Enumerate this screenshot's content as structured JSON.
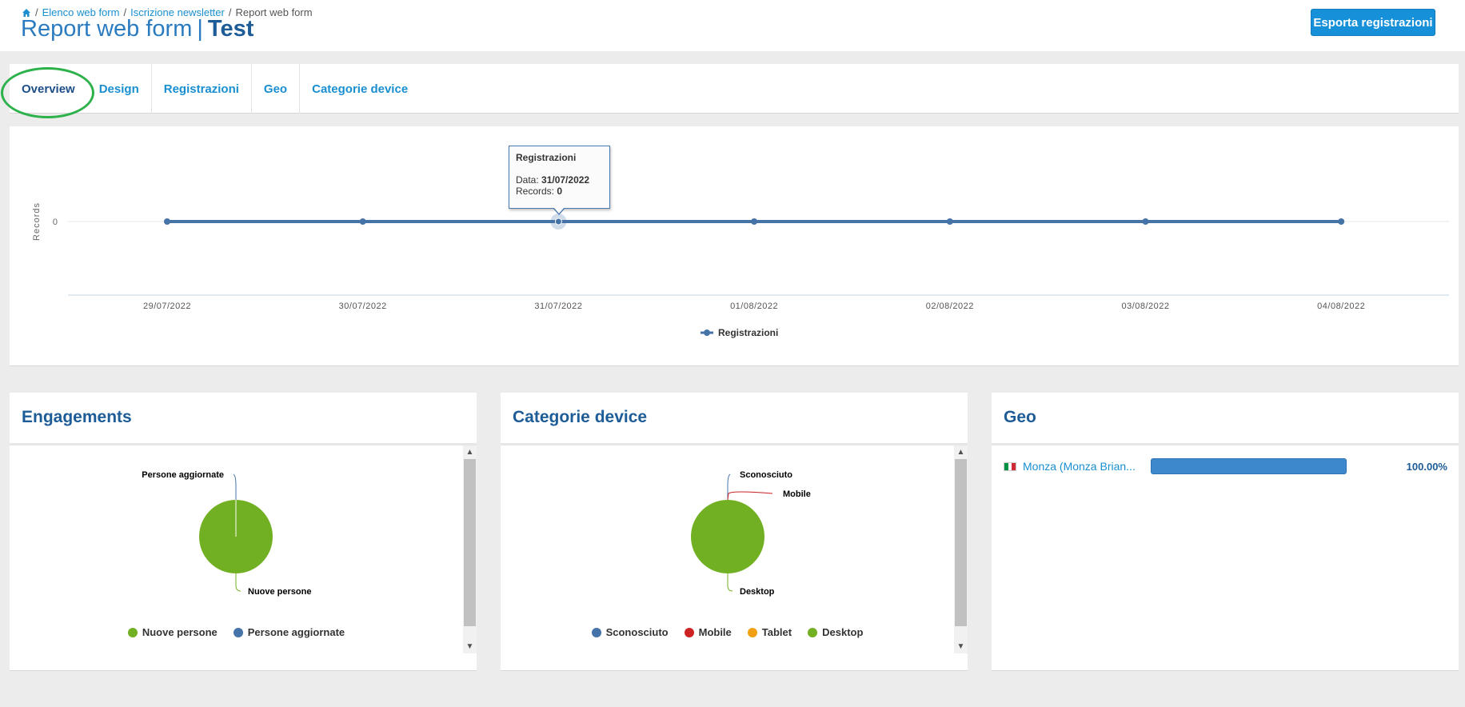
{
  "breadcrumb": {
    "items": [
      "Elenco web form",
      "Iscrizione newsletter"
    ],
    "current": "Report web form",
    "separator": "/"
  },
  "title": {
    "main": "Report web form",
    "separator": "|",
    "name": "Test"
  },
  "export_button": "Esporta registrazioni",
  "tabs": [
    "Overview",
    "Design",
    "Registrazioni",
    "Geo",
    "Categorie device"
  ],
  "active_tab": "Overview",
  "chart_data": {
    "type": "line",
    "x": [
      "29/07/2022",
      "30/07/2022",
      "31/07/2022",
      "01/08/2022",
      "02/08/2022",
      "03/08/2022",
      "04/08/2022"
    ],
    "series": [
      {
        "name": "Registrazioni",
        "values": [
          0,
          0,
          0,
          0,
          0,
          0,
          0
        ],
        "color": "#4572a7"
      }
    ],
    "ylabel": "Records",
    "yticks": [
      "0"
    ],
    "legend": "bottom-center",
    "tooltip": {
      "title": "Registrazioni",
      "date_label": "Data:",
      "date_value": "31/07/2022",
      "records_label": "Records:",
      "records_value": "0",
      "hovered_point_index": 2
    }
  },
  "engagements": {
    "title": "Engagements",
    "pie_labels": [
      "Persone aggiornate",
      "Nuove persone"
    ],
    "legend": [
      {
        "label": "Nuove persone",
        "color": "#72b023"
      },
      {
        "label": "Persone aggiornate",
        "color": "#4572a7"
      }
    ],
    "pie_color": "#72b023"
  },
  "devices": {
    "title": "Categorie device",
    "pie_labels": [
      "Sconosciuto",
      "Mobile",
      "Desktop"
    ],
    "legend": [
      {
        "label": "Sconosciuto",
        "color": "#4572a7"
      },
      {
        "label": "Mobile",
        "color": "#cc2222"
      },
      {
        "label": "Tablet",
        "color": "#f0a010"
      },
      {
        "label": "Desktop",
        "color": "#72b023"
      }
    ],
    "pie_color": "#72b023"
  },
  "geo": {
    "title": "Geo",
    "rows": [
      {
        "label": "Monza  (Monza Brian...",
        "percent_text": "100.00%",
        "fraction": 1.0,
        "flag": "italy-flag"
      }
    ]
  },
  "colors": {
    "accent": "#1690d8",
    "title_blue": "#1d5c96",
    "highlight_circle": "#2db14a"
  }
}
